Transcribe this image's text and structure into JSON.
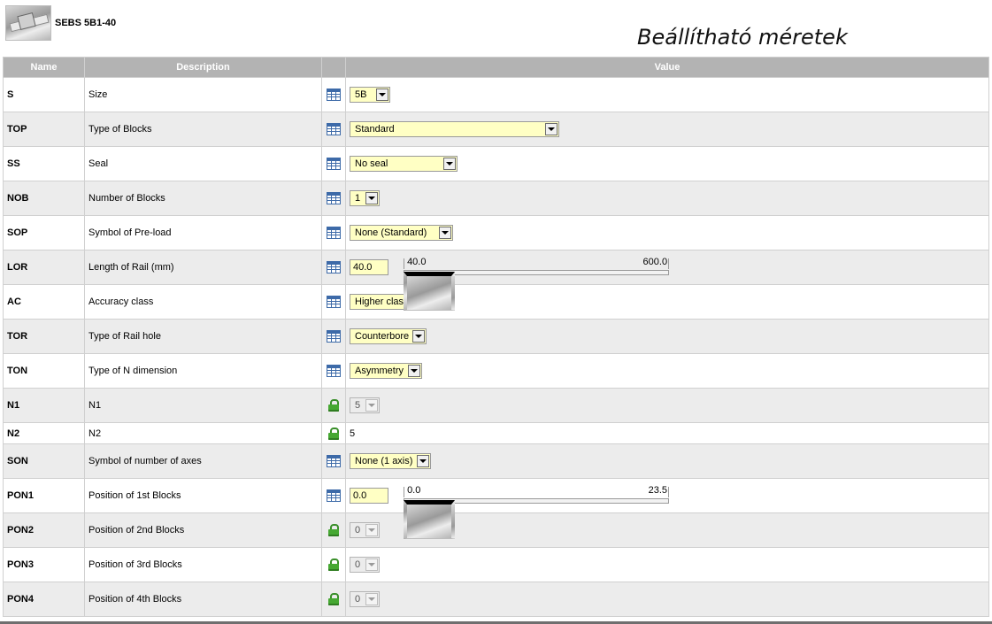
{
  "header": {
    "product_code": "SEBS 5B1-40",
    "page_heading": "Beállítható méretek"
  },
  "columns": {
    "name": "Name",
    "description": "Description",
    "value": "Value"
  },
  "rows": [
    {
      "name": "S",
      "description": "Size",
      "icon": "table-icon",
      "value": "5B"
    },
    {
      "name": "TOP",
      "description": "Type of Blocks",
      "icon": "table-icon",
      "value": "Standard"
    },
    {
      "name": "SS",
      "description": "Seal",
      "icon": "table-icon",
      "value": "No seal"
    },
    {
      "name": "NOB",
      "description": "Number of Blocks",
      "icon": "table-icon",
      "value": "1"
    },
    {
      "name": "SOP",
      "description": "Symbol of Pre-load",
      "icon": "table-icon",
      "value": "None (Standard)"
    },
    {
      "name": "LOR",
      "description": "Length of Rail (mm)",
      "icon": "table-icon",
      "value": "40.0",
      "slider_min": "40.0",
      "slider_max": "600.0",
      "slider_position": 0
    },
    {
      "name": "AC",
      "description": "Accuracy class",
      "icon": "table-icon",
      "value": "Higher class"
    },
    {
      "name": "TOR",
      "description": "Type of Rail hole",
      "icon": "table-icon",
      "value": "Counterbore"
    },
    {
      "name": "TON",
      "description": "Type of N dimension",
      "icon": "table-icon",
      "value": "Asymmetry"
    },
    {
      "name": "N1",
      "description": "N1",
      "icon": "lock-icon",
      "value": "5",
      "disabled": true
    },
    {
      "name": "N2",
      "description": "N2",
      "icon": "lock-icon",
      "value": "5"
    },
    {
      "name": "SON",
      "description": "Symbol of number of axes",
      "icon": "table-icon",
      "value": "None (1 axis)"
    },
    {
      "name": "PON1",
      "description": "Position of 1st Blocks",
      "icon": "table-icon",
      "value": "0.0",
      "slider_min": "0.0",
      "slider_max": "23.5",
      "slider_position": 0
    },
    {
      "name": "PON2",
      "description": "Position of 2nd Blocks",
      "icon": "lock-icon",
      "value": "0",
      "disabled": true
    },
    {
      "name": "PON3",
      "description": "Position of 3rd Blocks",
      "icon": "lock-icon",
      "value": "0",
      "disabled": true
    },
    {
      "name": "PON4",
      "description": "Position of 4th Blocks",
      "icon": "lock-icon",
      "value": "0",
      "disabled": true
    }
  ]
}
